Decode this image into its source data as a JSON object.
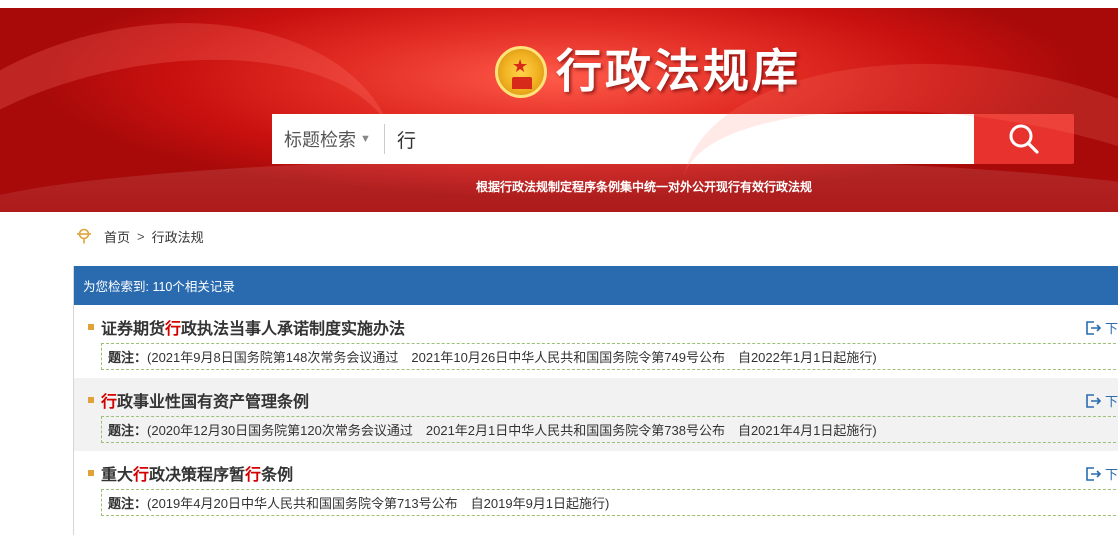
{
  "header": {
    "site_title": "行政法规库",
    "slogan": "根据行政法规制定程序条例集中统一对外公开现行有效行政法规",
    "search": {
      "type_label": "标题检索",
      "value": "行"
    }
  },
  "breadcrumb": {
    "home": "首页",
    "separator": ">",
    "current": "行政法规"
  },
  "results": {
    "summary": "为您检索到: 110个相关记录",
    "note_label": "题注：",
    "download_label": "下",
    "items": [
      {
        "title_parts": [
          "证券期货",
          "行",
          "政执法当事人承诺制度实施办法"
        ],
        "note": "(2021年9月8日国务院第148次常务会议通过　2021年10月26日中华人民共和国国务院令第749号公布　自2022年1月1日起施行)"
      },
      {
        "title_parts": [
          "",
          "行",
          "政事业性国有资产管理条例"
        ],
        "note": "(2020年12月30日国务院第120次常务会议通过　2021年2月1日中华人民共和国国务院令第738号公布　自2021年4月1日起施行)"
      },
      {
        "title_parts": [
          "重大",
          "行",
          "政决策程序暂",
          "行",
          "条例"
        ],
        "note": "(2019年4月20日中华人民共和国国务院令第713号公布　自2019年9月1日起施行)"
      }
    ]
  },
  "colors": {
    "banner_red": "#c8110f",
    "search_button": "#e8322d",
    "panel_head": "#2a6bb0",
    "highlight": "#d40000",
    "bullet": "#e2a23a"
  }
}
